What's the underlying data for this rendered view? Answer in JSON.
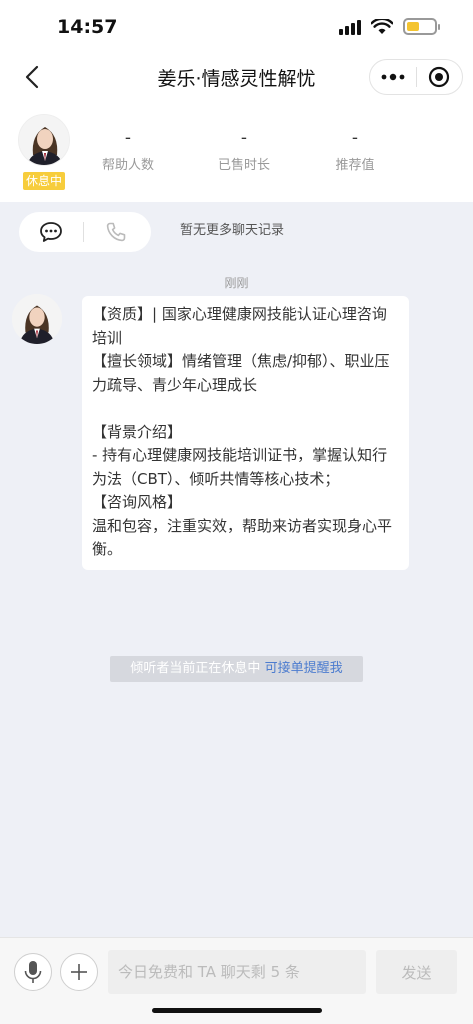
{
  "status_bar": {
    "time": "14:57",
    "battery_level": 0.45
  },
  "nav": {
    "title": "姜乐·情感灵性解忧",
    "icons": [
      "back-arrow-icon",
      "more-dots-icon",
      "close-circle-icon"
    ]
  },
  "profile": {
    "avatar": "counselor-avatar",
    "status_badge": "休息中",
    "stats": [
      {
        "value": "-",
        "label": "帮助人数"
      },
      {
        "value": "-",
        "label": "已售时长"
      },
      {
        "value": "-",
        "label": "推荐值"
      }
    ]
  },
  "chat_tools": {
    "icons": [
      "chat-bubble-icon",
      "phone-icon"
    ],
    "no_more_text": "暂无更多聊天记录"
  },
  "time_label": "刚刚",
  "message": {
    "lines": [
      "【资质】| 国家心理健康网技能认证心理咨询培训",
      "【擅长领域】情绪管理（焦虑/抑郁）、职业压力疏导、青少年心理成长",
      "",
      "【背景介绍】",
      "- 持有心理健康网技能培训证书，掌握认知行为法（CBT）、倾听共情等核心技术；",
      "【咨询风格】",
      "温和包容，注重实效，帮助来访者实现身心平衡。"
    ]
  },
  "rest_notice": {
    "text": "倾听者当前正在休息中",
    "link": "可接单提醒我"
  },
  "input_bar": {
    "placeholder": "今日免费和 TA 聊天剩 5 条",
    "send_label": "发送",
    "icons": [
      "microphone-icon",
      "plus-icon"
    ]
  },
  "colors": {
    "badge": "#f7cd3c",
    "link": "#4c7ccf",
    "background": "#eef0f6"
  }
}
